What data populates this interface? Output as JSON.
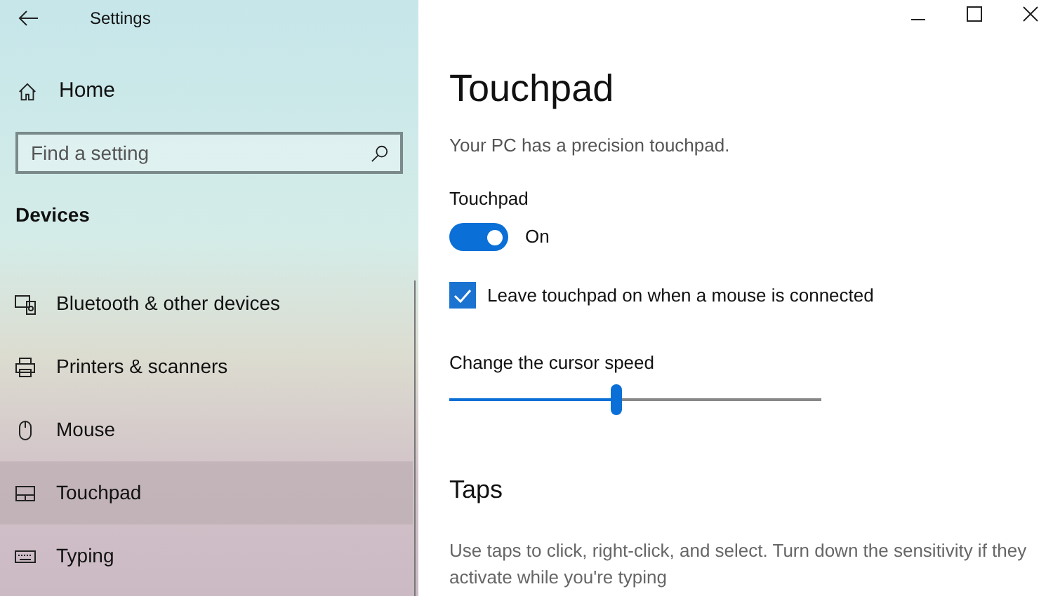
{
  "window": {
    "title": "Settings"
  },
  "sidebar": {
    "home": "Home",
    "search": {
      "placeholder": "Find a setting"
    },
    "section": "Devices",
    "items": [
      {
        "label": "Bluetooth & other devices",
        "selected": false
      },
      {
        "label": "Printers & scanners",
        "selected": false
      },
      {
        "label": "Mouse",
        "selected": false
      },
      {
        "label": "Touchpad",
        "selected": true
      },
      {
        "label": "Typing",
        "selected": false
      }
    ]
  },
  "page": {
    "title": "Touchpad",
    "description": "Your PC has a precision touchpad.",
    "toggle": {
      "label": "Touchpad",
      "on": true,
      "state_text": "On"
    },
    "checkbox": {
      "label": "Leave touchpad on when a mouse is connected",
      "checked": true
    },
    "slider": {
      "label": "Change the cursor speed",
      "level": 0.45
    },
    "section": "Taps",
    "section_text": "Use taps to click, right-click, and select. Turn down the sensitivity if they activate while you're typing"
  }
}
